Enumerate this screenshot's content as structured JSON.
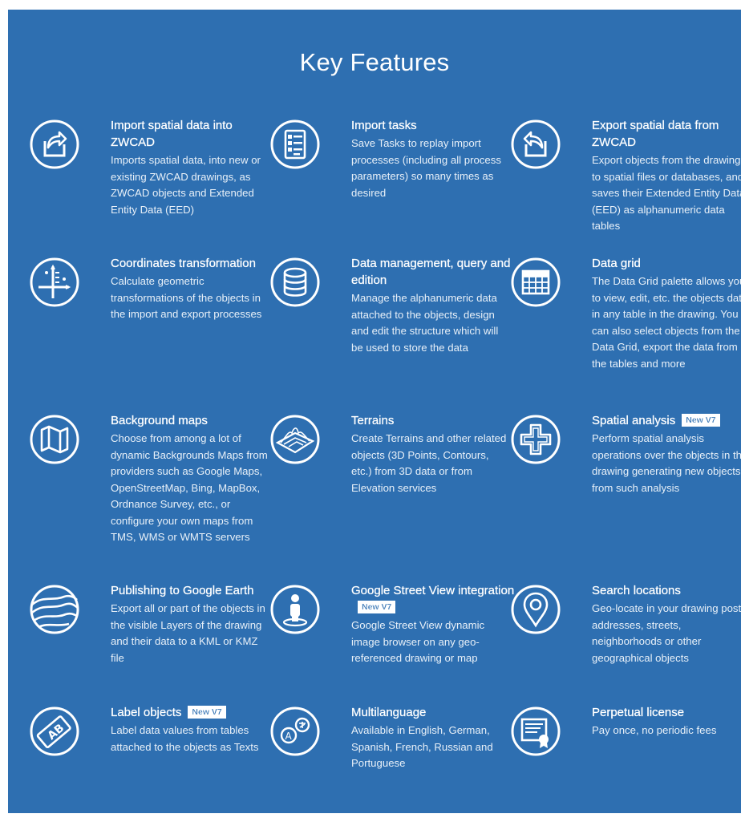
{
  "page": {
    "title": "Key Features",
    "background": "#2e6fb1",
    "badge_text": "New V7"
  },
  "features": [
    {
      "title": "Import spatial data into ZWCAD",
      "description": "Imports spatial data, into new or existing ZWCAD drawings, as ZWCAD objects and Extended Entity Data (EED)",
      "icon": "import-arrow-icon"
    },
    {
      "title": "Import tasks",
      "description": "Save Tasks to replay import processes (including all process parameters) so many times as desired",
      "icon": "checklist-icon"
    },
    {
      "title": "Export spatial data from ZWCAD",
      "description": "Export objects from the drawing to spatial files or databases, and saves their Extended Entity Data (EED) as alphanumeric data tables",
      "icon": "export-arrow-icon"
    },
    {
      "title": "Coordinates transformation",
      "description": "Calculate geometric transformations of the objects in the import and export processes",
      "icon": "axes-icon"
    },
    {
      "title": "Data management, query and edition",
      "description": "Manage the alphanumeric data attached to the objects, design and edit the structure which will be used to store the data",
      "icon": "database-icon"
    },
    {
      "title": "Data grid",
      "description": "The Data Grid palette allows you to view, edit, etc. the objects data in any table in the drawing. You can also select objects from the Data Grid, export the data from the tables and more",
      "icon": "grid-table-icon"
    },
    {
      "title": "Background maps",
      "description": "Choose from among a lot of dynamic Backgrounds Maps from providers such as Google Maps, OpenStreetMap, Bing, MapBox, Ordnance Survey, etc., or configure your own maps from TMS, WMS or WMTS servers",
      "icon": "folded-map-icon"
    },
    {
      "title": "Terrains",
      "description": "Create Terrains and other related objects (3D Points, Contours, etc.) from 3D data or from Elevation services",
      "icon": "terrain-icon"
    },
    {
      "title": "Spatial analysis",
      "badge": "New V7",
      "description": "Perform spatial analysis operations over the objects in the drawing generating new objects from such analysis",
      "icon": "spatial-union-icon"
    },
    {
      "title": "Publishing to Google Earth",
      "description": "Export all or part of the objects in the visible Layers of the drawing and their data to a KML or KMZ file",
      "icon": "globe-icon"
    },
    {
      "title": "Google Street View integration",
      "badge": "New V7",
      "description": "Google Street View dynamic image browser on any geo-referenced drawing or map",
      "icon": "pegman-icon"
    },
    {
      "title": "Search locations",
      "description": "Geo-locate in your drawing postal addresses, streets, neighborhoods or other geographical objects",
      "icon": "map-pin-icon"
    },
    {
      "title": "Label objects",
      "badge": "New V7",
      "description": "Label data values from tables attached to the objects as Texts",
      "icon": "label-tag-icon"
    },
    {
      "title": "Multilanguage",
      "description": "Available in English, German, Spanish, French, Russian and Portuguese",
      "icon": "language-bubbles-icon"
    },
    {
      "title": "Perpetual license",
      "description": "Pay once, no periodic fees",
      "icon": "certificate-icon"
    }
  ]
}
